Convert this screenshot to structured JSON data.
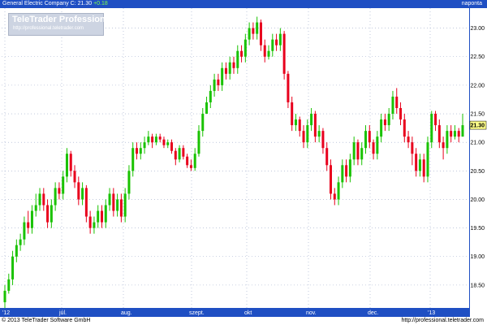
{
  "header": {
    "symbol_text": "General Electric Company C: 21.30",
    "change_text": "+0.18",
    "right_label": "naponta"
  },
  "watermark": {
    "brand": "TeleTrader",
    "brand_suffix": "Professional",
    "url": "http://professional.teletrader.com"
  },
  "footer": {
    "copyright": "© 2013 TeleTrader Software GmbH",
    "url": "http://professional.teletrader.com"
  },
  "colors": {
    "up": "#19c200",
    "down": "#e8001c",
    "axis_bar": "#1f4fc3",
    "grid": "#9aa7c8",
    "last_price_bg": "#ffff88"
  },
  "chart_data": {
    "type": "candlestick",
    "title": "",
    "xlabel": "",
    "ylabel": "",
    "ylim": [
      18.1,
      23.35
    ],
    "y_ticks": [
      "18.50",
      "19.00",
      "19.50",
      "20.00",
      "20.50",
      "21.00",
      "21.50",
      "22.00",
      "22.50",
      "23.00"
    ],
    "x_tick_labels": [
      "'12",
      "júl.",
      "aug.",
      "szept.",
      "okt",
      "nov.",
      "dec.",
      "'13"
    ],
    "last_price": "21.30",
    "candles": [
      [
        18.4,
        18.2,
        18.5,
        18.1
      ],
      [
        18.6,
        18.4,
        18.7,
        18.35
      ],
      [
        19.0,
        18.6,
        19.1,
        18.5
      ],
      [
        19.2,
        19.0,
        19.3,
        18.9
      ],
      [
        19.3,
        19.2,
        19.4,
        19.1
      ],
      [
        19.6,
        19.3,
        19.7,
        19.2
      ],
      [
        19.5,
        19.6,
        19.8,
        19.4
      ],
      [
        19.8,
        19.5,
        19.9,
        19.4
      ],
      [
        19.9,
        19.8,
        20.1,
        19.7
      ],
      [
        20.1,
        19.9,
        20.2,
        19.8
      ],
      [
        19.9,
        20.1,
        20.2,
        19.8
      ],
      [
        19.6,
        19.9,
        20.0,
        19.5
      ],
      [
        19.9,
        19.6,
        20.0,
        19.5
      ],
      [
        20.2,
        19.9,
        20.3,
        19.8
      ],
      [
        20.1,
        20.2,
        20.3,
        20.0
      ],
      [
        20.4,
        20.1,
        20.5,
        20.0
      ],
      [
        20.8,
        20.4,
        20.9,
        20.3
      ],
      [
        20.5,
        20.8,
        20.85,
        20.4
      ],
      [
        20.3,
        20.5,
        20.6,
        20.2
      ],
      [
        20.0,
        20.3,
        20.4,
        19.9
      ],
      [
        20.2,
        20.0,
        20.3,
        19.9
      ],
      [
        19.7,
        20.2,
        20.25,
        19.6
      ],
      [
        19.5,
        19.7,
        19.8,
        19.4
      ],
      [
        19.6,
        19.5,
        19.7,
        19.4
      ],
      [
        19.8,
        19.6,
        19.9,
        19.5
      ],
      [
        19.6,
        19.8,
        19.9,
        19.5
      ],
      [
        19.9,
        19.6,
        20.0,
        19.5
      ],
      [
        20.1,
        19.9,
        20.2,
        19.8
      ],
      [
        19.8,
        20.1,
        20.2,
        19.7
      ],
      [
        20.0,
        19.8,
        20.1,
        19.7
      ],
      [
        19.7,
        20.0,
        20.1,
        19.6
      ],
      [
        20.1,
        19.7,
        20.2,
        19.6
      ],
      [
        20.5,
        20.1,
        20.6,
        20.0
      ],
      [
        20.9,
        20.5,
        21.0,
        20.4
      ],
      [
        20.8,
        20.9,
        21.0,
        20.7
      ],
      [
        20.9,
        20.8,
        21.0,
        20.7
      ],
      [
        21.0,
        20.9,
        21.1,
        20.8
      ],
      [
        21.1,
        21.0,
        21.2,
        20.95
      ],
      [
        21.0,
        21.1,
        21.15,
        20.9
      ],
      [
        21.1,
        21.0,
        21.15,
        20.95
      ],
      [
        21.05,
        21.1,
        21.15,
        21.0
      ],
      [
        20.95,
        21.05,
        21.1,
        20.9
      ],
      [
        21.0,
        20.95,
        21.05,
        20.9
      ],
      [
        20.85,
        21.0,
        21.05,
        20.8
      ],
      [
        20.7,
        20.85,
        20.9,
        20.6
      ],
      [
        20.9,
        20.7,
        20.95,
        20.65
      ],
      [
        20.75,
        20.9,
        20.95,
        20.7
      ],
      [
        20.6,
        20.75,
        20.8,
        20.55
      ],
      [
        20.55,
        20.6,
        20.7,
        20.5
      ],
      [
        20.8,
        20.55,
        20.9,
        20.5
      ],
      [
        21.2,
        20.8,
        21.3,
        20.75
      ],
      [
        21.5,
        21.2,
        21.6,
        21.1
      ],
      [
        21.7,
        21.5,
        21.8,
        21.6
      ],
      [
        21.9,
        21.7,
        22.0,
        21.6
      ],
      [
        22.1,
        21.9,
        22.2,
        21.8
      ],
      [
        22.0,
        22.1,
        22.2,
        21.9
      ],
      [
        22.3,
        22.0,
        22.4,
        21.9
      ],
      [
        22.2,
        22.3,
        22.4,
        22.1
      ],
      [
        22.4,
        22.2,
        22.5,
        22.1
      ],
      [
        22.3,
        22.4,
        22.5,
        22.2
      ],
      [
        22.6,
        22.3,
        22.7,
        22.2
      ],
      [
        22.5,
        22.6,
        22.7,
        22.4
      ],
      [
        22.8,
        22.5,
        22.9,
        22.4
      ],
      [
        23.0,
        22.8,
        23.1,
        22.7
      ],
      [
        22.9,
        23.0,
        23.1,
        22.8
      ],
      [
        23.1,
        22.9,
        23.2,
        22.8
      ],
      [
        22.7,
        23.1,
        23.15,
        22.6
      ],
      [
        22.5,
        22.7,
        22.8,
        22.4
      ],
      [
        22.6,
        22.5,
        22.7,
        22.45
      ],
      [
        22.8,
        22.6,
        22.9,
        22.5
      ],
      [
        22.7,
        22.8,
        22.9,
        22.6
      ],
      [
        22.9,
        22.7,
        23.0,
        22.6
      ],
      [
        22.2,
        22.9,
        22.95,
        22.1
      ],
      [
        21.7,
        22.2,
        22.25,
        21.6
      ],
      [
        21.3,
        21.7,
        21.8,
        21.2
      ],
      [
        21.4,
        21.3,
        21.5,
        21.2
      ],
      [
        21.2,
        21.4,
        21.45,
        21.1
      ],
      [
        21.0,
        21.2,
        21.3,
        20.9
      ],
      [
        21.3,
        21.0,
        21.4,
        20.9
      ],
      [
        21.5,
        21.3,
        21.6,
        21.2
      ],
      [
        21.1,
        21.5,
        21.55,
        21.0
      ],
      [
        21.2,
        21.1,
        21.3,
        21.0
      ],
      [
        20.9,
        21.2,
        21.25,
        20.8
      ],
      [
        20.6,
        20.9,
        21.0,
        20.5
      ],
      [
        20.1,
        20.6,
        20.7,
        20.0
      ],
      [
        20.0,
        20.1,
        20.2,
        19.9
      ],
      [
        20.3,
        20.0,
        20.4,
        19.9
      ],
      [
        20.6,
        20.3,
        20.7,
        20.2
      ],
      [
        20.4,
        20.6,
        20.7,
        20.3
      ],
      [
        20.7,
        20.4,
        20.8,
        20.3
      ],
      [
        21.0,
        20.7,
        21.1,
        20.6
      ],
      [
        20.7,
        21.0,
        21.05,
        20.6
      ],
      [
        20.9,
        20.7,
        21.0,
        20.6
      ],
      [
        21.2,
        20.9,
        21.3,
        20.8
      ],
      [
        21.0,
        21.2,
        21.3,
        20.9
      ],
      [
        20.8,
        21.0,
        21.05,
        20.7
      ],
      [
        21.1,
        20.8,
        21.2,
        20.7
      ],
      [
        21.4,
        21.1,
        21.5,
        21.0
      ],
      [
        21.3,
        21.4,
        21.5,
        21.2
      ],
      [
        21.5,
        21.3,
        21.6,
        21.2
      ],
      [
        21.8,
        21.5,
        21.9,
        21.4
      ],
      [
        21.6,
        21.8,
        21.95,
        21.5
      ],
      [
        21.4,
        21.6,
        21.7,
        21.3
      ],
      [
        21.1,
        21.4,
        21.5,
        21.0
      ],
      [
        21.0,
        21.1,
        21.2,
        20.9
      ],
      [
        20.8,
        21.0,
        21.1,
        20.6
      ],
      [
        20.5,
        20.8,
        20.9,
        20.4
      ],
      [
        20.7,
        20.5,
        20.8,
        20.4
      ],
      [
        20.4,
        20.7,
        20.8,
        20.3
      ],
      [
        21.0,
        20.4,
        21.1,
        20.3
      ],
      [
        21.5,
        21.0,
        21.55,
        20.9
      ],
      [
        21.3,
        21.5,
        21.55,
        21.2
      ],
      [
        21.0,
        21.3,
        21.4,
        20.9
      ],
      [
        20.9,
        21.0,
        21.1,
        20.7
      ],
      [
        21.2,
        20.9,
        21.3,
        20.8
      ],
      [
        21.1,
        21.2,
        21.3,
        21.0
      ],
      [
        21.2,
        21.1,
        21.3,
        21.05
      ],
      [
        21.1,
        21.2,
        21.25,
        21.0
      ],
      [
        21.3,
        21.1,
        21.5,
        21.1
      ]
    ]
  }
}
